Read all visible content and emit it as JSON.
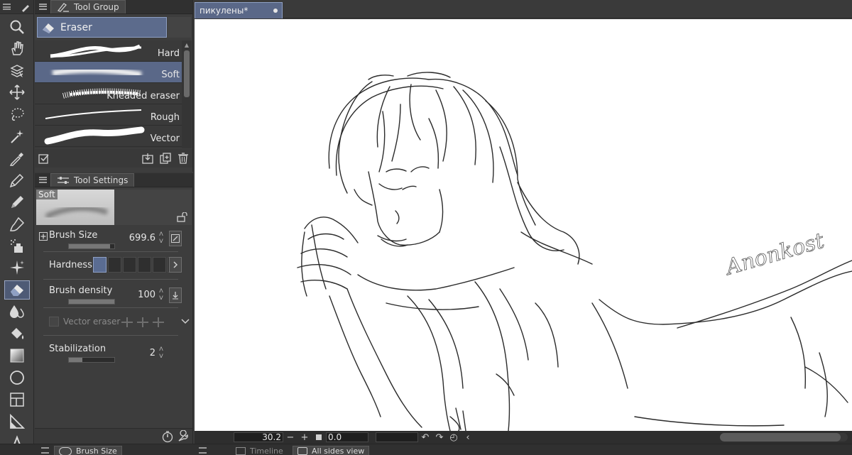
{
  "toolbar": {
    "tools": [
      {
        "name": "zoom-icon"
      },
      {
        "name": "hand-icon"
      },
      {
        "name": "operation-icon"
      },
      {
        "name": "move-icon"
      },
      {
        "name": "lasso-icon"
      },
      {
        "name": "magic-wand-icon"
      },
      {
        "name": "eyedropper-icon"
      },
      {
        "name": "pen-icon"
      },
      {
        "name": "pencil-icon"
      },
      {
        "name": "brush-icon"
      },
      {
        "name": "airbrush-icon"
      },
      {
        "name": "decoration-icon"
      },
      {
        "name": "eraser-icon",
        "active": true
      },
      {
        "name": "blend-icon"
      },
      {
        "name": "fill-icon"
      },
      {
        "name": "gradient-icon"
      },
      {
        "name": "figure-icon"
      },
      {
        "name": "frame-icon"
      },
      {
        "name": "ruler-icon"
      },
      {
        "name": "text-icon"
      }
    ]
  },
  "tool_group": {
    "tab_label": "Tool Group",
    "sub_tool_label": "Eraser",
    "brushes": [
      {
        "label": "Hard",
        "selected": false
      },
      {
        "label": "Soft",
        "selected": true
      },
      {
        "label": "Kneaded eraser",
        "selected": false
      },
      {
        "label": "Rough",
        "selected": false
      },
      {
        "label": "Vector",
        "selected": false
      }
    ]
  },
  "tool_settings": {
    "tab_label": "Tool Settings",
    "preview_label": "Soft",
    "brush_size": {
      "label": "Brush Size",
      "value": "699.6",
      "fill": 0.9
    },
    "hardness": {
      "label": "Hardness",
      "level": 1,
      "steps": 6
    },
    "brush_density": {
      "label": "Brush density",
      "value": "100",
      "fill": 1.0
    },
    "vector_eraser": {
      "label": "Vector eraser"
    },
    "stabilization": {
      "label": "Stabilization",
      "value": "2",
      "fill": 0.3
    }
  },
  "document": {
    "tab_label": "пикулены*",
    "signature": "Anonkost"
  },
  "navigator": {
    "zoom": "30.2",
    "rotation": "0.0"
  },
  "bottom_panels": {
    "brush_size_tab": "Brush Size",
    "timeline_tab": "Timeline",
    "all_sides_tab": "All sides view"
  },
  "colors": {
    "accent": "#5a6888",
    "accent_border": "#8fa0c4",
    "panel_bg": "#3d3d3d",
    "canvas_bg": "#ffffff"
  }
}
